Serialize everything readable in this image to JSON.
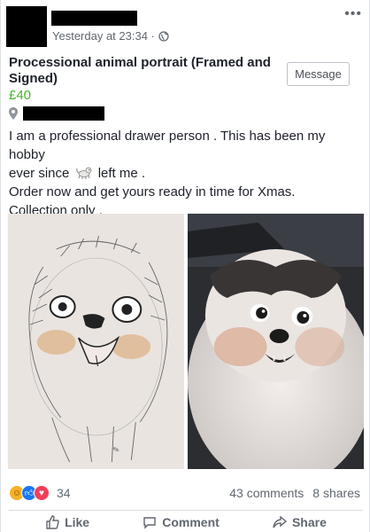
{
  "post": {
    "timestamp": "Yesterday at 23:34 ·",
    "title": "Processional animal portrait (Framed and Signed)",
    "price": "£40",
    "message_button": "Message",
    "body": {
      "line1": "I am a professional drawer person . This has been my hobby",
      "line2_before": "ever since",
      "line2_after": "left me .",
      "line3": "Order now and get yours ready in time for Xmas.",
      "line4": "Collection only ."
    }
  },
  "photos": [
    {
      "name": "drawing-of-dog"
    },
    {
      "name": "photo-of-dog"
    }
  ],
  "stats": {
    "reactions_count": "34",
    "comments": "43 comments",
    "shares": "8 shares"
  },
  "actions": {
    "like": "Like",
    "comment": "Comment",
    "share": "Share"
  },
  "colors": {
    "price_green": "#42b72a",
    "link_blue": "#1877f2",
    "muted": "#606770"
  }
}
